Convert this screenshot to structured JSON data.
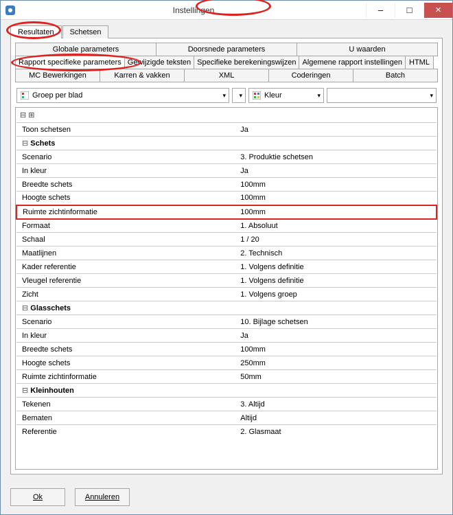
{
  "window": {
    "title": "Instellingen"
  },
  "tabs_main": [
    {
      "label": "Resultaten",
      "active": true
    },
    {
      "label": "Schetsen",
      "active": false
    }
  ],
  "subtabs_row1": [
    "Globale parameters",
    "Doorsnede parameters",
    "U waarden"
  ],
  "subtabs_row2": [
    "Rapport specifieke parameters",
    "Gewijzigde teksten",
    "Specifieke berekeningswijzen",
    "Algemene rapport instellingen",
    "HTML"
  ],
  "subtabs_row3": [
    "MC Bewerkingen",
    "Karren & vakken",
    "XML",
    "Coderingen",
    "Batch"
  ],
  "subtabs_active_row": 1,
  "subtabs_active_index": 0,
  "dropdowns": {
    "group": "Groep per blad",
    "small": "",
    "colormode": "Kleur",
    "last": ""
  },
  "grid_toolbar": "⊟ ⊞",
  "rows": [
    {
      "k": "Toon schetsen",
      "v": "Ja"
    },
    {
      "section": "Schets"
    },
    {
      "k": "Scenario",
      "v": "3. Produktie schetsen"
    },
    {
      "k": "In kleur",
      "v": "Ja"
    },
    {
      "k": "Breedte schets",
      "v": "100mm"
    },
    {
      "k": "Hoogte schets",
      "v": "100mm"
    },
    {
      "k": "Ruimte zichtinformatie",
      "v": "100mm",
      "highlight": true
    },
    {
      "k": "Formaat",
      "v": "1. Absoluut"
    },
    {
      "k": "Schaal",
      "v": "1 / 20"
    },
    {
      "k": "Maatlijnen",
      "v": "2. Technisch"
    },
    {
      "k": "Kader referentie",
      "v": "1. Volgens definitie"
    },
    {
      "k": "Vleugel referentie",
      "v": "1. Volgens definitie"
    },
    {
      "k": "Zicht",
      "v": "1. Volgens groep"
    },
    {
      "section": "Glasschets"
    },
    {
      "k": "Scenario",
      "v": "10. Bijlage schetsen"
    },
    {
      "k": "In kleur",
      "v": "Ja"
    },
    {
      "k": "Breedte schets",
      "v": "100mm"
    },
    {
      "k": "Hoogte schets",
      "v": "250mm"
    },
    {
      "k": "Ruimte zichtinformatie",
      "v": "50mm"
    },
    {
      "section": "Kleinhouten"
    },
    {
      "k": "Tekenen",
      "v": "3. Altijd"
    },
    {
      "k": "Bematen",
      "v": "Altijd"
    },
    {
      "k": "Referentie",
      "v": "2. Glasmaat"
    }
  ],
  "buttons": {
    "ok": "Ok",
    "cancel": "Annuleren"
  }
}
